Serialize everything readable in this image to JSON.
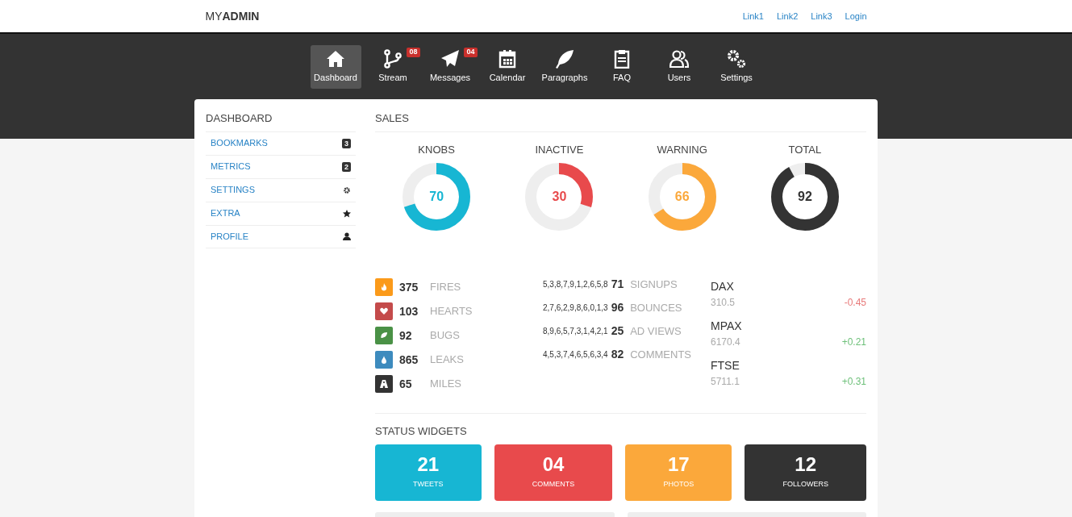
{
  "brand": {
    "light": "MY",
    "bold": "ADMIN"
  },
  "top_links": [
    "Link1",
    "Link2",
    "Link3",
    "Login"
  ],
  "nav": [
    {
      "label": "Dashboard",
      "selected": true
    },
    {
      "label": "Stream",
      "selected": false,
      "badge": "08"
    },
    {
      "label": "Messages",
      "selected": false,
      "badge": "04"
    },
    {
      "label": "Calendar",
      "selected": false
    },
    {
      "label": "Paragraphs",
      "selected": false
    },
    {
      "label": "FAQ",
      "selected": false
    },
    {
      "label": "Users",
      "selected": false
    },
    {
      "label": "Settings",
      "selected": false
    }
  ],
  "sidebar": {
    "title": "DASHBOARD",
    "items": [
      {
        "label": "BOOKMARKS",
        "kind": "count",
        "count": "3"
      },
      {
        "label": "METRICS",
        "kind": "count",
        "count": "2"
      },
      {
        "label": "SETTINGS",
        "kind": "icon"
      },
      {
        "label": "EXTRA",
        "kind": "icon"
      },
      {
        "label": "PROFILE",
        "kind": "icon"
      }
    ]
  },
  "sales": {
    "title": "SALES",
    "donuts": [
      {
        "label": "KNOBS",
        "value": "70",
        "level": 0.7,
        "color": "#17b6d3"
      },
      {
        "label": "INACTIVE",
        "value": "30",
        "level": 0.3,
        "color": "#e84a4c"
      },
      {
        "label": "WARNING",
        "value": "66",
        "level": 0.66,
        "color": "#fba83b"
      },
      {
        "label": "TOTAL",
        "value": "92",
        "level": 0.92,
        "color": "#333333"
      }
    ]
  },
  "stats": [
    {
      "value": "375",
      "label": "FIRES",
      "color": "#fb9a1a"
    },
    {
      "value": "103",
      "label": "HEARTS",
      "color": "#c44b4b"
    },
    {
      "value": "92",
      "label": "BUGS",
      "color": "#4a9146"
    },
    {
      "value": "865",
      "label": "LEAKS",
      "color": "#3d8bbe"
    },
    {
      "value": "65",
      "label": "MILES",
      "color": "#333333"
    }
  ],
  "sparks": [
    {
      "series": "5,3,8,7,9,1,2,6,5,8",
      "value": "71",
      "label": "SIGNUPS"
    },
    {
      "series": "2,7,6,2,9,8,6,0,1,3",
      "value": "96",
      "label": "BOUNCES"
    },
    {
      "series": "8,9,6,5,7,3,1,4,2,1",
      "value": "25",
      "label": "AD VIEWS"
    },
    {
      "series": "4,5,3,7,4,6,5,6,3,4",
      "value": "82",
      "label": "COMMENTS"
    }
  ],
  "tickers": [
    {
      "name": "DAX",
      "price": "310.5",
      "change": "-0.45",
      "color": "#e87a7a"
    },
    {
      "name": "MPAX",
      "price": "6170.4",
      "change": "+0.21",
      "color": "#6ec07a"
    },
    {
      "name": "FTSE",
      "price": "5711.1",
      "change": "+0.31",
      "color": "#6ec07a"
    }
  ],
  "status_widgets": {
    "title": "STATUS WIDGETS",
    "items": [
      {
        "value": "21",
        "label": "TWEETS",
        "color": "#17b6d3"
      },
      {
        "value": "04",
        "label": "COMMENTS",
        "color": "#e84a4c"
      },
      {
        "value": "17",
        "label": "PHOTOS",
        "color": "#fba83b"
      },
      {
        "value": "12",
        "label": "FOLLOWERS",
        "color": "#333333"
      }
    ]
  }
}
